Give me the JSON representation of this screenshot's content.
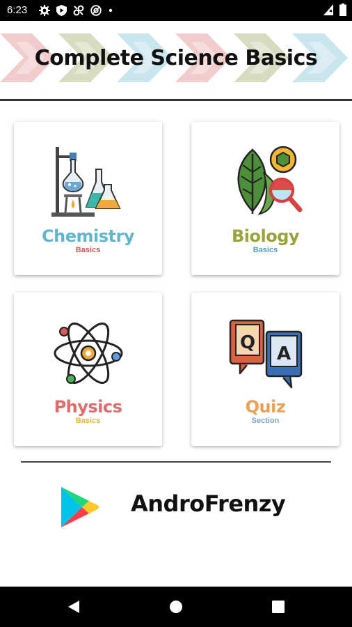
{
  "status_bar": {
    "time": "6:23",
    "left_icons": [
      "gear-icon",
      "shield-play-icon",
      "pinwheel-icon",
      "at-icon",
      "dot-icon"
    ],
    "right_icons": [
      "signal-icon",
      "battery-icon"
    ]
  },
  "header": {
    "title": "Complete Science Basics",
    "chevron_colors": [
      "#e8a0a0",
      "#b5c08a",
      "#9ccfe0",
      "#e8a0a0",
      "#b5c08a",
      "#9ccfe0"
    ]
  },
  "cards": [
    {
      "title": "Chemistry",
      "subtitle": "Basics",
      "title_color": "#5fb8cf",
      "subtitle_color": "#d9534f",
      "icon": "chemistry-lab-icon"
    },
    {
      "title": "Biology",
      "subtitle": "Basics",
      "title_color": "#9aa33a",
      "subtitle_color": "#4a9fc9",
      "icon": "leaf-magnifier-icon"
    },
    {
      "title": "Physics",
      "subtitle": "Basics",
      "title_color": "#e26a6a",
      "subtitle_color": "#f0b24a",
      "icon": "atom-icon"
    },
    {
      "title": "Quiz",
      "subtitle": "Section",
      "title_color": "#f0a050",
      "subtitle_color": "#7aa3d6",
      "icon": "qa-books-icon"
    }
  ],
  "footer": {
    "developer": "AndroFrenzy",
    "store_icon": "google-play-icon"
  },
  "nav_bar": {
    "buttons": [
      "back-button",
      "home-button",
      "recents-button"
    ]
  }
}
